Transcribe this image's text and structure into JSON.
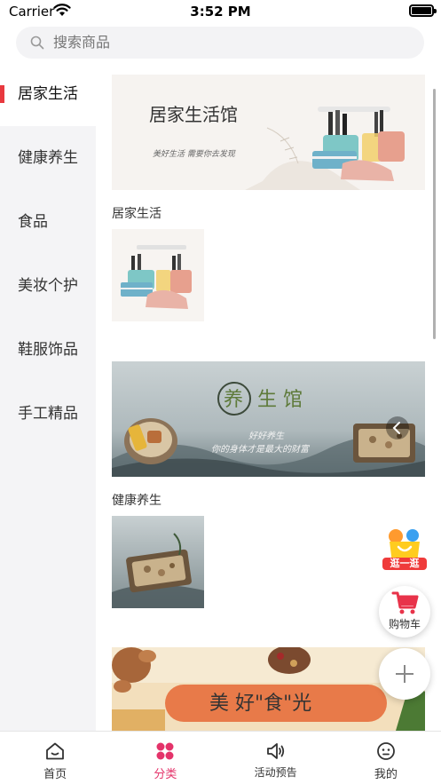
{
  "status_bar": {
    "carrier": "Carrier",
    "time": "3:52 PM"
  },
  "search": {
    "placeholder": "搜索商品"
  },
  "sidebar": {
    "items": [
      {
        "label": "居家生活",
        "active": true
      },
      {
        "label": "健康养生",
        "active": false
      },
      {
        "label": "食品",
        "active": false
      },
      {
        "label": "美妆个护",
        "active": false
      },
      {
        "label": "鞋服饰品",
        "active": false
      },
      {
        "label": "手工精品",
        "active": false
      }
    ]
  },
  "sections": [
    {
      "banner_title": "居家生活馆",
      "banner_subtitle": "美好生活  需要你去发现",
      "title": "居家生活"
    },
    {
      "banner_title_char1": "养",
      "banner_title_rest": "生 馆",
      "banner_sub1": "好好养生",
      "banner_sub2": "你的身体才是最大的财富",
      "title": "健康养生"
    },
    {
      "banner_title": "美 好\"食\"光"
    }
  ],
  "floating": {
    "stroll_label": "逛一逛",
    "cart_label": "购物车"
  },
  "tabs": [
    {
      "label": "首页",
      "icon": "home-icon"
    },
    {
      "label": "分类",
      "icon": "category-icon"
    },
    {
      "label": "活动预告",
      "icon": "megaphone-icon"
    },
    {
      "label": "我的",
      "icon": "profile-icon"
    }
  ],
  "colors": {
    "accent": "#e4336a",
    "indicator": "#e8393f",
    "sidebar_bg": "#f4f4f6"
  }
}
